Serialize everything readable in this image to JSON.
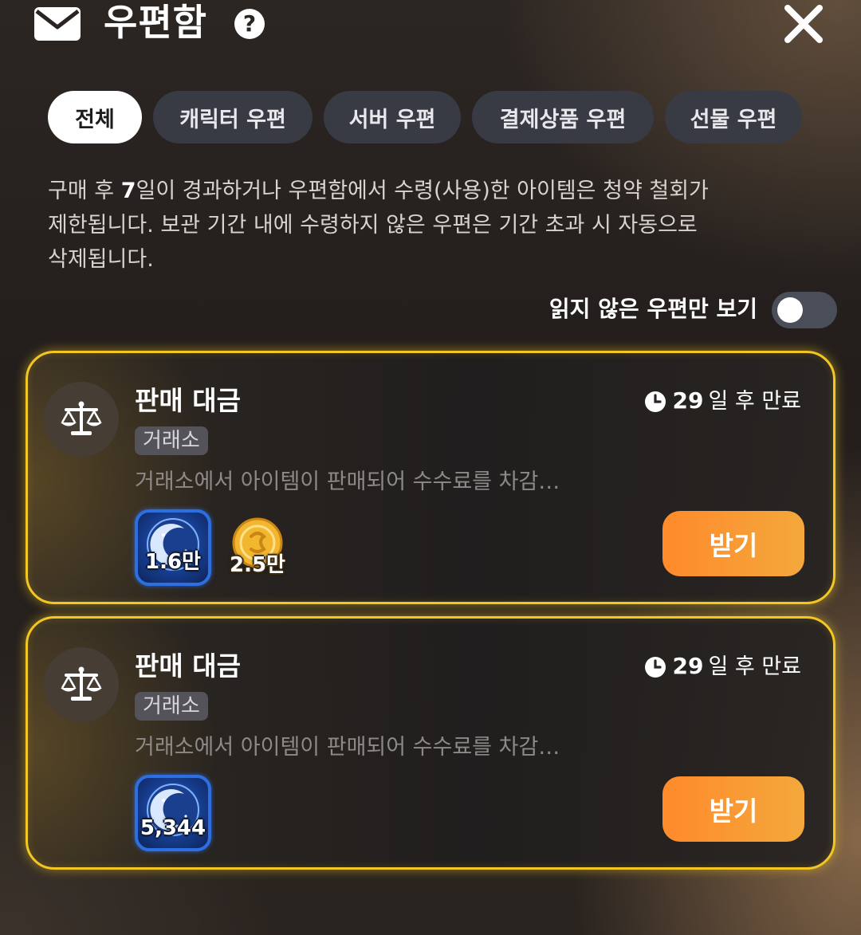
{
  "header": {
    "title": "우편함",
    "help_glyph": "?",
    "icons": {
      "mail": "mail-icon",
      "help": "help-icon",
      "close": "close-icon"
    }
  },
  "tabs": [
    {
      "label": "전체",
      "active": true
    },
    {
      "label": "캐릭터 우편",
      "active": false
    },
    {
      "label": "서버 우편",
      "active": false
    },
    {
      "label": "결제상품 우편",
      "active": false
    },
    {
      "label": "선물 우편",
      "active": false
    }
  ],
  "notice": {
    "line1_pre": "구매 후 ",
    "line1_bold": "7",
    "line1_post": "일이 경과하거나 우편함에서 수령(사용)한 아이템은 청약 철회가",
    "line2": "제한됩니다. 보관 기간 내에 수령하지 않은 우편은 기간 초과 시 자동으로",
    "line3": "삭제됩니다."
  },
  "filter": {
    "unread_only_label": "읽지 않은 우편만 보기",
    "unread_only_enabled": false
  },
  "mails": [
    {
      "title": "판매 대금",
      "tag": "거래소",
      "expiry_days": "29",
      "expiry_suffix": "일 후 만료",
      "description": "거래소에서 아이템이 판매되어 수수료를 차감…",
      "rewards": [
        {
          "type": "gem",
          "qty": "1.6만"
        },
        {
          "type": "coin",
          "qty": "2.5만"
        }
      ],
      "claim_label": "받기",
      "sender_icon": "scale-icon"
    },
    {
      "title": "판매 대금",
      "tag": "거래소",
      "expiry_days": "29",
      "expiry_suffix": "일 후 만료",
      "description": "거래소에서 아이템이 판매되어 수수료를 차감…",
      "rewards": [
        {
          "type": "gem",
          "qty": "5,344"
        }
      ],
      "claim_label": "받기",
      "sender_icon": "scale-icon"
    }
  ],
  "colors": {
    "accent_gold": "#f3c623",
    "claim_button_start": "#ff8a2b",
    "claim_button_end": "#f4a83c",
    "tab_inactive": "#383a44",
    "tab_active": "#ffffff"
  }
}
